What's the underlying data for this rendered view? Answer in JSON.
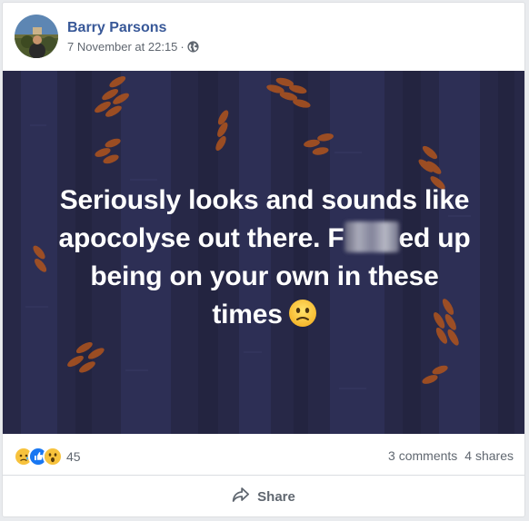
{
  "post": {
    "author": "Barry Parsons",
    "timestamp": "7 November at 22:15",
    "separator": "·",
    "privacy_icon": "globe-icon",
    "text_lines": [
      "Seriously looks and sounds like",
      "apocolyse out there. F",
      "ed up",
      "being on your own in these",
      "times"
    ],
    "emoji": "confused-face-emoji"
  },
  "stats": {
    "reaction_icons": [
      "sad-reaction-icon",
      "like-reaction-icon",
      "wow-reaction-icon"
    ],
    "reaction_count": "45",
    "comments": "3 comments",
    "shares": "4 shares"
  },
  "actions": {
    "share_label": "Share",
    "share_icon": "share-arrow-icon"
  },
  "colors": {
    "author_link": "#385898",
    "meta_text": "#606770",
    "image_background": "#272847",
    "leaf_orange": "#b0541d",
    "post_text": "#ffffff"
  }
}
